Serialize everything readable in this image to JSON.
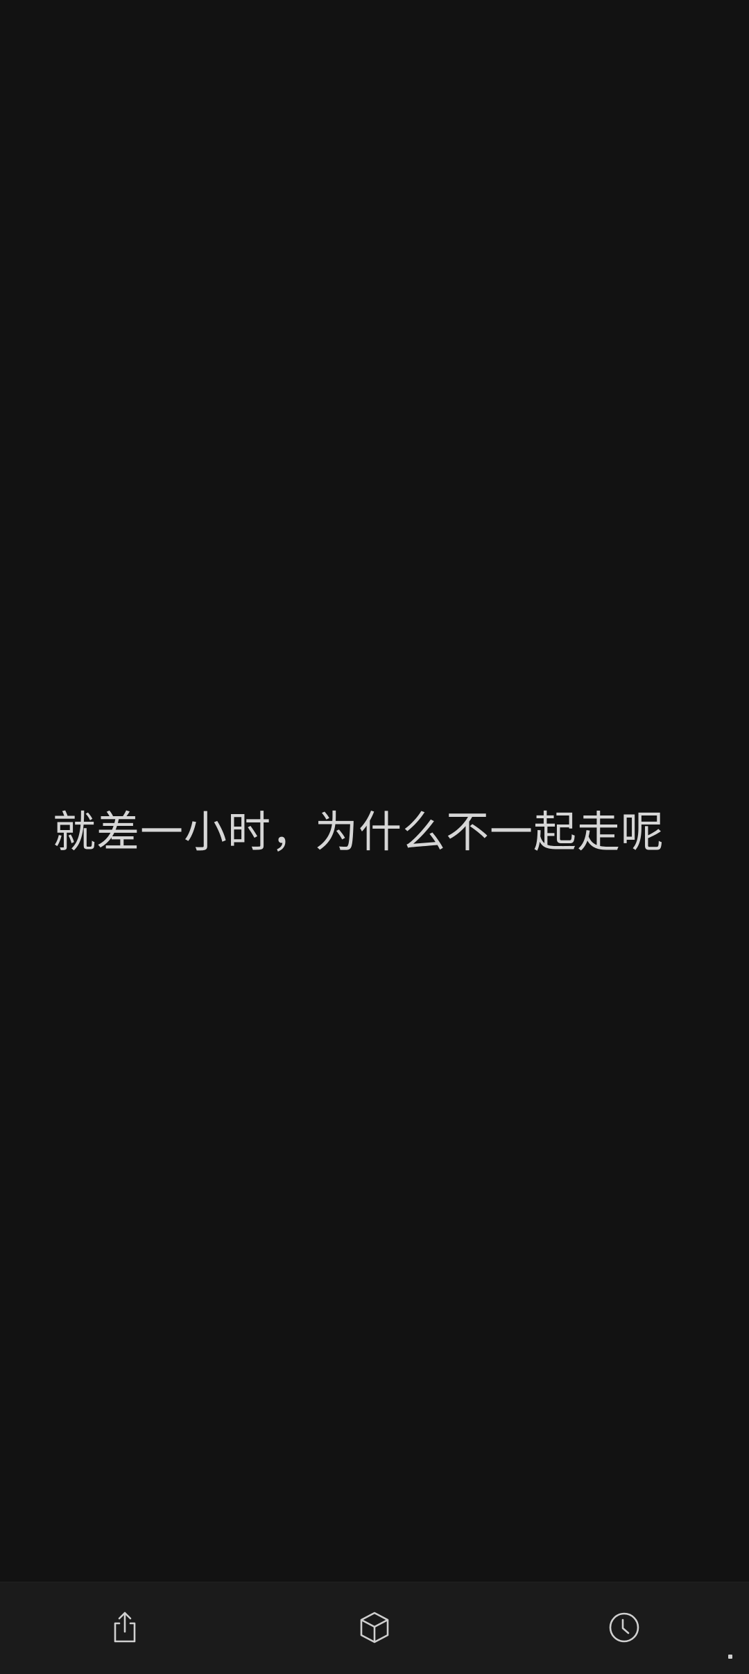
{
  "content": {
    "quote": "就差一小时，为什么不一起走呢"
  },
  "bottom_bar": {
    "buttons": [
      {
        "icon": "share-icon"
      },
      {
        "icon": "cube-icon"
      },
      {
        "icon": "clock-icon"
      }
    ]
  },
  "colors": {
    "background": "#121212",
    "bar_background": "#1b1b1b",
    "text": "#d6d6d6",
    "icon": "#d0d0d0"
  }
}
